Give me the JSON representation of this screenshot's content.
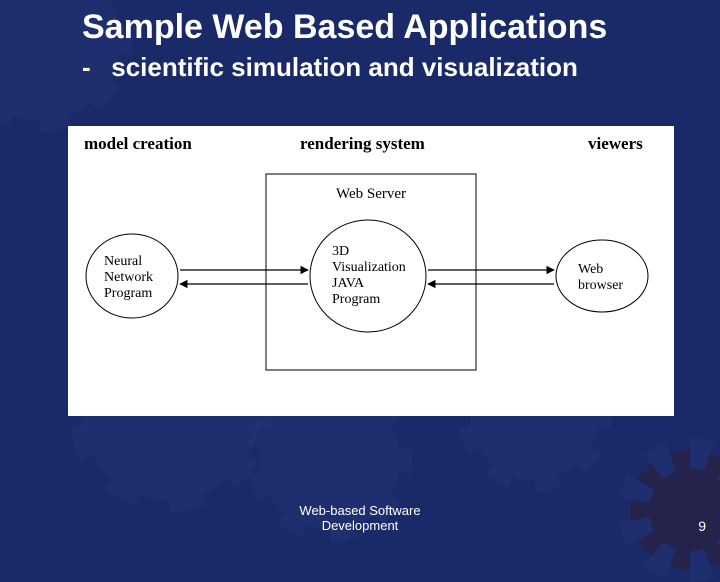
{
  "slide": {
    "title": "Sample Web Based Applications",
    "bullet_dash": "-",
    "subtitle": "scientific simulation and visualization"
  },
  "diagram": {
    "columns": {
      "left": "model creation",
      "middle": "rendering system",
      "right": "viewers"
    },
    "container_label": "Web Server",
    "nodes": {
      "neural": "Neural\nNetwork\nProgram",
      "viz": "3D\nVisualization\nJAVA\nProgram",
      "browser": "Web\nbrowser"
    },
    "arrows": [
      {
        "from": "neural",
        "to": "viz",
        "bidirectional": true
      },
      {
        "from": "viz",
        "to": "browser",
        "bidirectional": true
      }
    ]
  },
  "footer": {
    "line1": "Web-based Software",
    "line2": "Development",
    "page": "9"
  }
}
